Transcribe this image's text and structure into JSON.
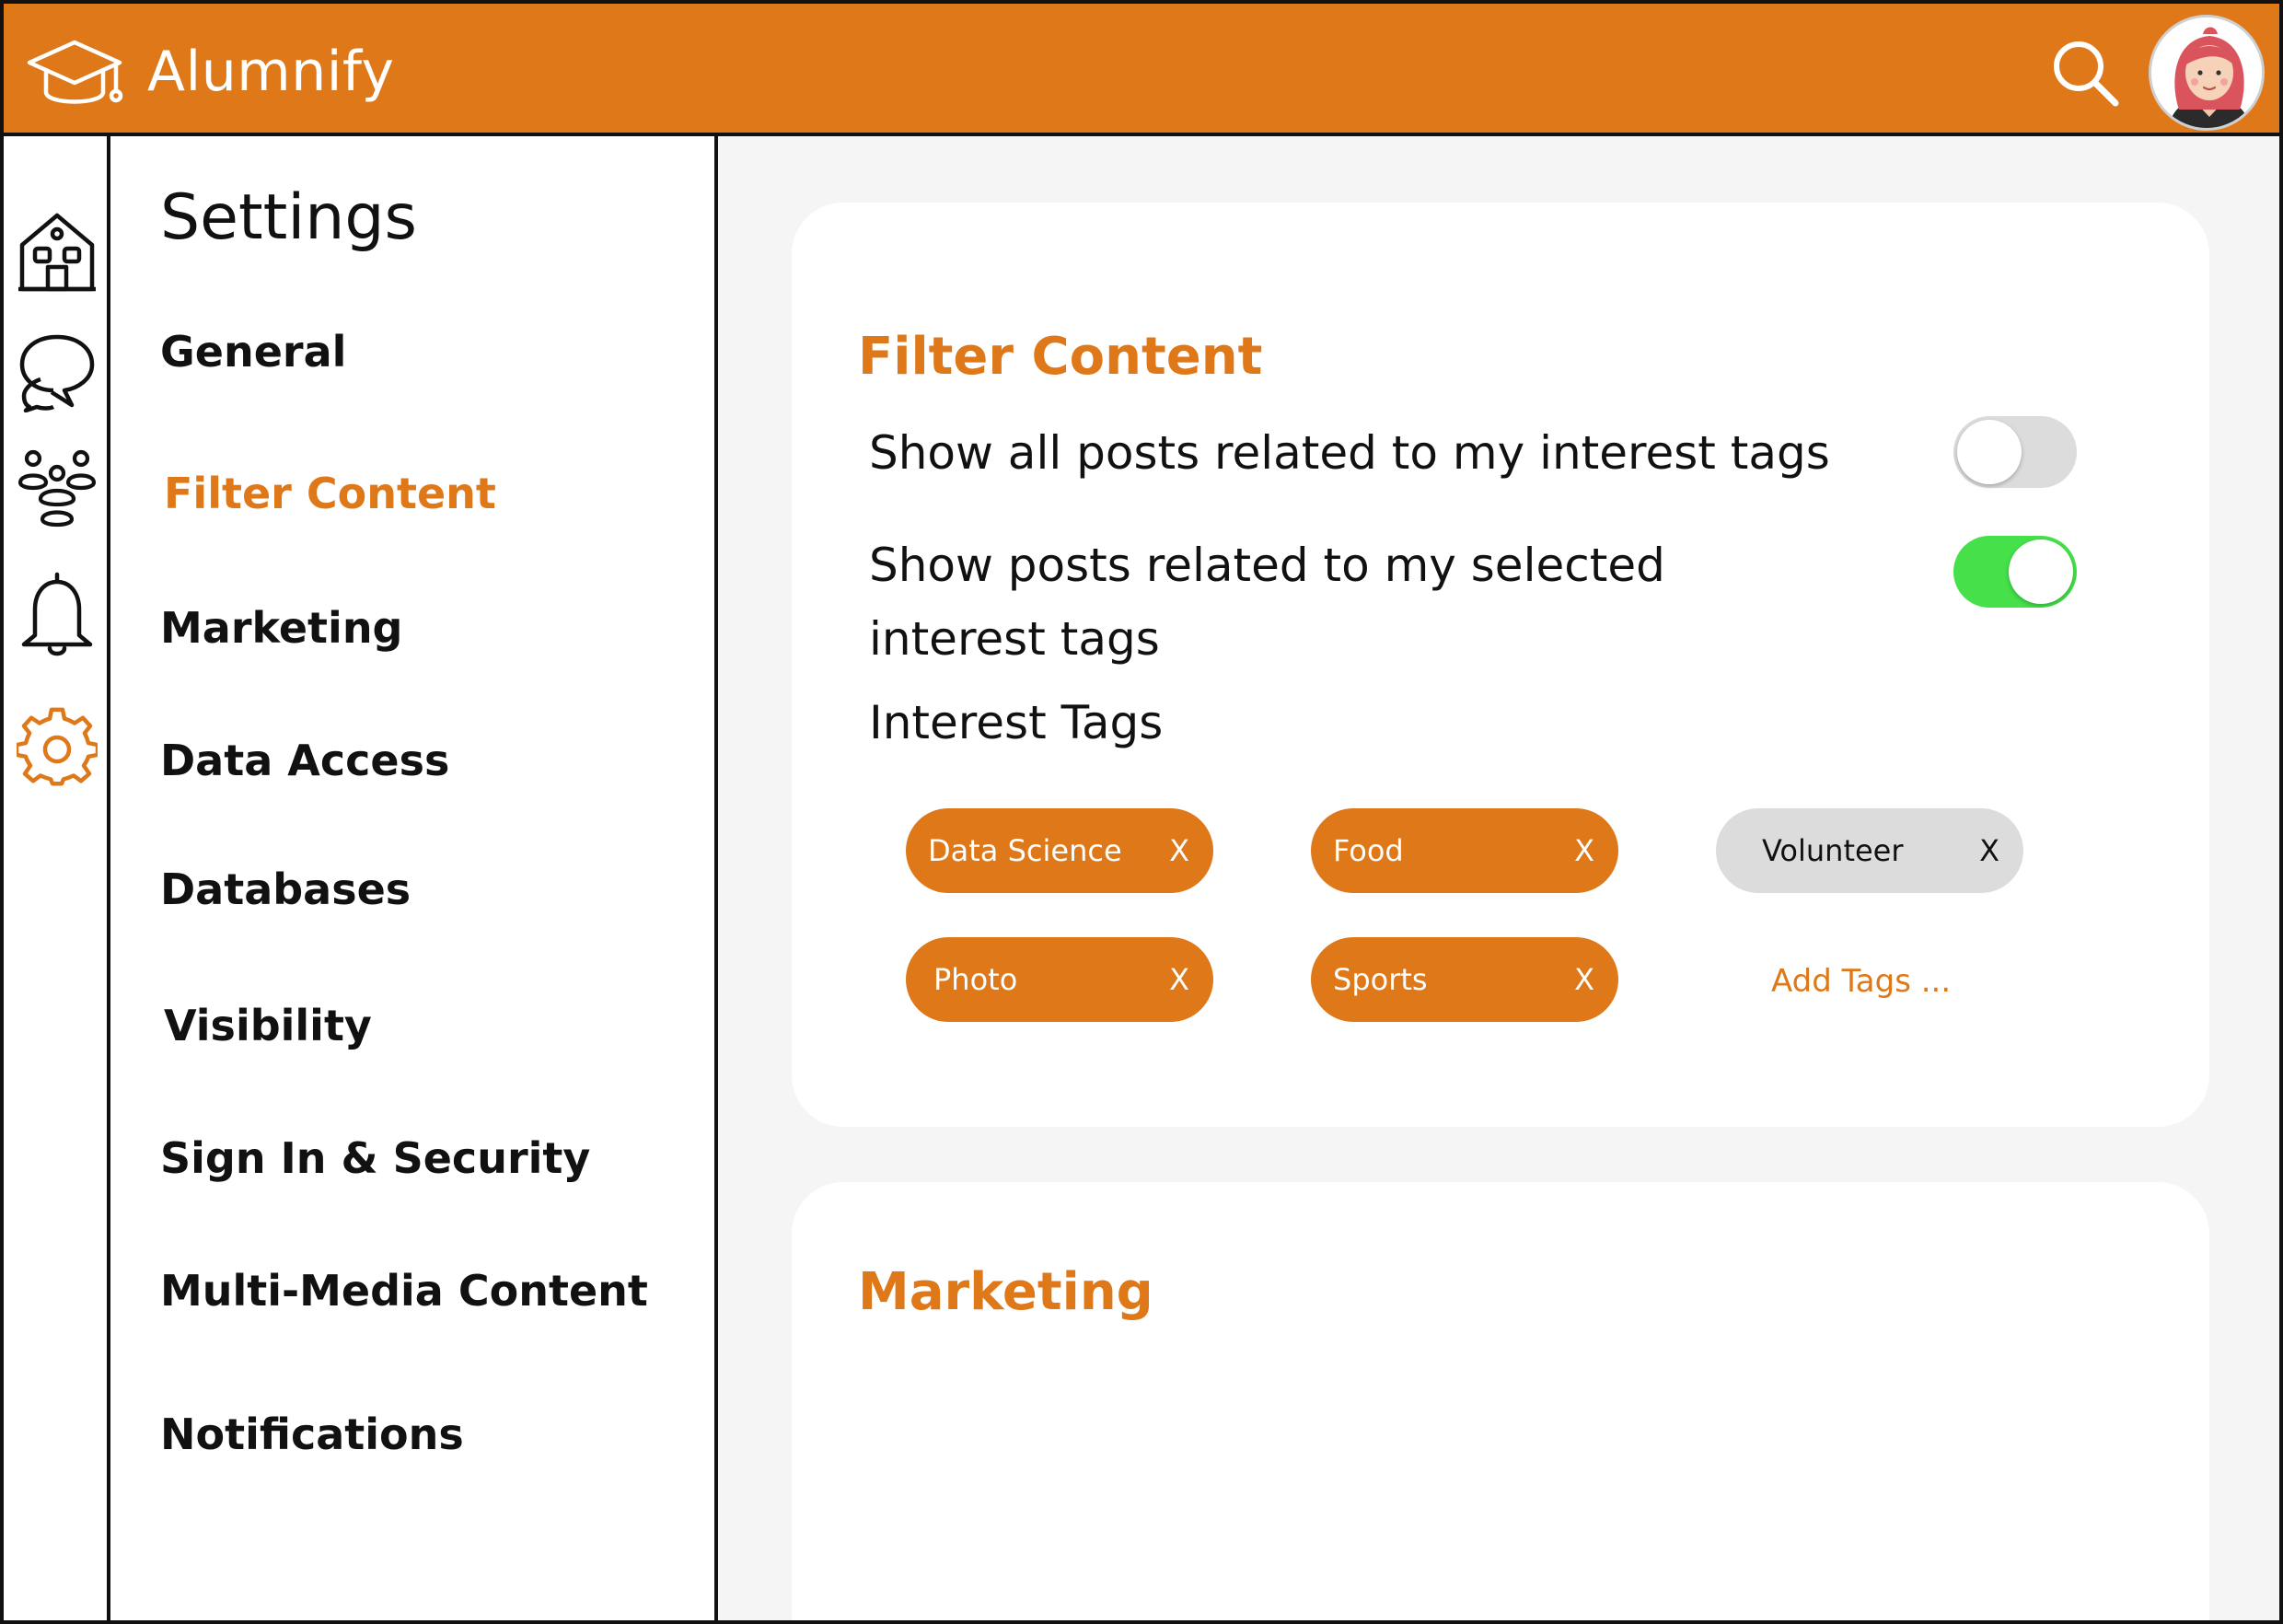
{
  "app": {
    "name": "Alumnify",
    "accent_color": "#de7819",
    "logo_icon": "graduation-cap-icon"
  },
  "header": {
    "search_icon": "search-icon",
    "avatar_icon": "user-avatar"
  },
  "rail": {
    "items": [
      {
        "icon": "home-icon",
        "active": false
      },
      {
        "icon": "chat-icon",
        "active": false
      },
      {
        "icon": "community-icon",
        "active": false
      },
      {
        "icon": "bell-icon",
        "active": false
      },
      {
        "icon": "gear-icon",
        "active": true
      }
    ]
  },
  "menu": {
    "title": "Settings",
    "items": [
      {
        "label": "General",
        "active": false
      },
      {
        "label": "Filter Content",
        "active": true
      },
      {
        "label": "Marketing",
        "active": false
      },
      {
        "label": "Data Access",
        "active": false
      },
      {
        "label": "Databases",
        "active": false
      },
      {
        "label": "Visibility",
        "active": false
      },
      {
        "label": "Sign In & Security",
        "active": false
      },
      {
        "label": "Multi-Media Content",
        "active": false
      },
      {
        "label": "Notifications",
        "active": false
      }
    ]
  },
  "filter": {
    "title": "Filter Content",
    "option_all": {
      "label": "Show all posts related to my interest tags",
      "enabled": false
    },
    "option_selected": {
      "label_line1": "Show posts related to my selected",
      "label_line2": "interest tags",
      "enabled": true
    },
    "tags_label": "Interest Tags",
    "tags": [
      {
        "label": "Data Science",
        "remove": "X",
        "selected": true
      },
      {
        "label": "Food",
        "remove": "X",
        "selected": true
      },
      {
        "label": "Volunteer",
        "remove": "X",
        "selected": false
      },
      {
        "label": "Photo",
        "remove": "X",
        "selected": true
      },
      {
        "label": "Sports",
        "remove": "X",
        "selected": true
      }
    ],
    "add_tags": "Add Tags ..."
  },
  "marketing": {
    "title": "Marketing"
  },
  "colors": {
    "toggle_on": "#45e04a",
    "toggle_off": "#dcdcdc",
    "tag_unselected": "#dcdcdc"
  }
}
